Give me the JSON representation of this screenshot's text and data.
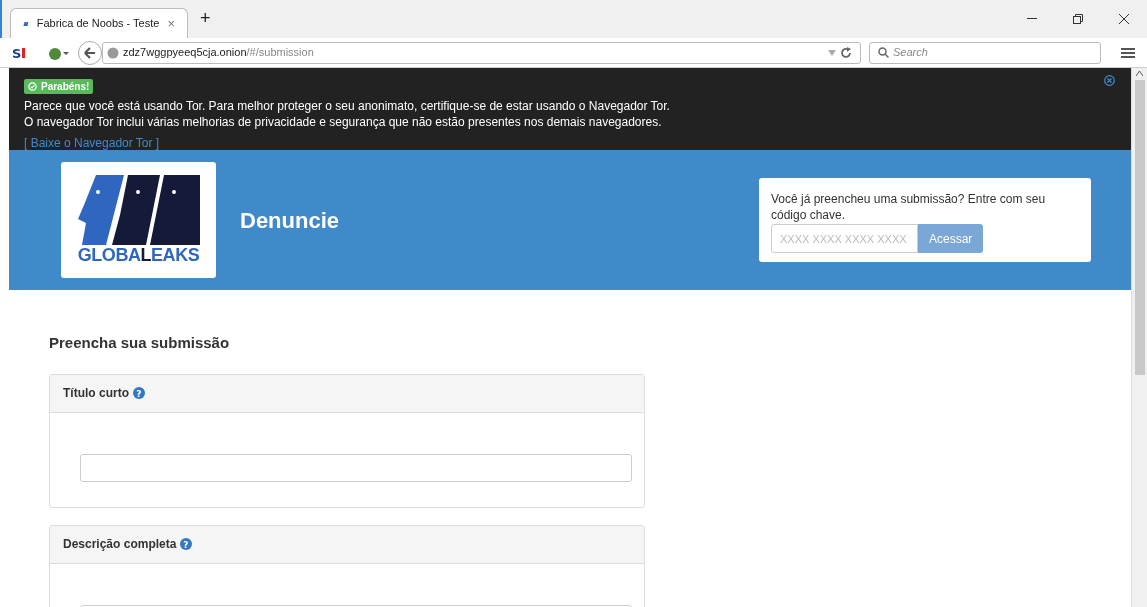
{
  "browser": {
    "addon_logo": "S",
    "tab": {
      "title": "Fabrica de Noobs - Teste",
      "close": "×",
      "selected": true
    },
    "new_tab": "+",
    "url_host": "zdz7wggpyeeq5cja.onion",
    "url_path": "/#/submission",
    "search": {
      "placeholder": "Search"
    }
  },
  "tor_notice": {
    "badge": "Parabéns!",
    "lines": [
      "Parece que você está usando Tor. Para melhor proteger o seu anonimato, certifique-se de estar usando o Navegador Tor.",
      "O navegador Tor inclui várias melhorias de privacidade e segurança que não estão presentes nos demais navegadores."
    ],
    "link": "[ Baixe o Navegador Tor ]"
  },
  "header": {
    "logo_text_1": "GLOBA",
    "logo_text_2": "L",
    "logo_text_3": "EAKS",
    "title": "Denuncie",
    "login": {
      "prompt": "Você já preencheu uma submissão? Entre com seu código chave.",
      "placeholder": "XXXX XXXX XXXX XXXX",
      "button": "Acessar"
    }
  },
  "form": {
    "title": "Preencha sua submissão",
    "fields": [
      {
        "label": "Título curto",
        "help": "?"
      },
      {
        "label": "Descrição completa",
        "help": "?"
      }
    ]
  }
}
